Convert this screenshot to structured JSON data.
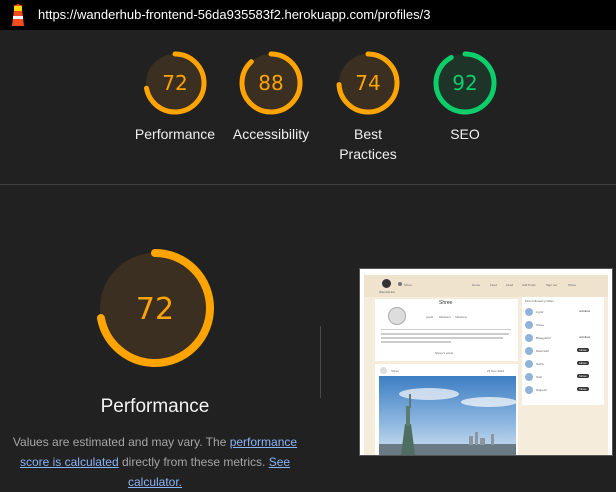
{
  "browser": {
    "url": "https://wanderhub-frontend-56da935583f2.herokuapp.com/profiles/3"
  },
  "scores": [
    {
      "label": "Performance",
      "score": 72,
      "status": "average"
    },
    {
      "label": "Accessibility",
      "score": 88,
      "status": "average"
    },
    {
      "label": "Best Practices",
      "score": 74,
      "status": "average"
    },
    {
      "label": "SEO",
      "score": 92,
      "status": "pass"
    }
  ],
  "colors": {
    "average": "#ffa400",
    "average_bg": "#3a2f20",
    "pass": "#0cce6b",
    "pass_bg": "#1e3428",
    "link": "#8ab4f8"
  },
  "main": {
    "score": 72,
    "title": "Performance",
    "desc_part1": "Values are estimated and may vary. The ",
    "link_score": "performance score is calculated",
    "desc_part2": " directly from these metrics. ",
    "link_calc": "See calculator."
  },
  "screenshot": {
    "nav_brand": "WanderHub",
    "nav_links": [
      "Home",
      "Feed",
      "Liked",
      "Add Posts",
      "Sign out",
      "Shree"
    ],
    "profile_name": "Shree",
    "stats": [
      "posts",
      "followers",
      "following"
    ],
    "bio": "Hi! I enjoy spending time outdoors, hiking, camping, and exploring nature. I love visiting places with beautiful scenery and wildlife.",
    "button": "Shree's posts",
    "post_author": "Shree",
    "post_date": "23 Dec 2023",
    "popular_title": "Most followed profiles",
    "popular": [
      {
        "name": "ingrid",
        "action": "unfollow"
      },
      {
        "name": "Shree",
        "action": ""
      },
      {
        "name": "Bhagyashri",
        "action": "unfollow"
      },
      {
        "name": "Rasma42",
        "action": "follow"
      },
      {
        "name": "Nisha",
        "action": "follow"
      },
      {
        "name": "Sudi",
        "action": "follow"
      },
      {
        "name": "Rajnesh",
        "action": "follow"
      }
    ]
  }
}
